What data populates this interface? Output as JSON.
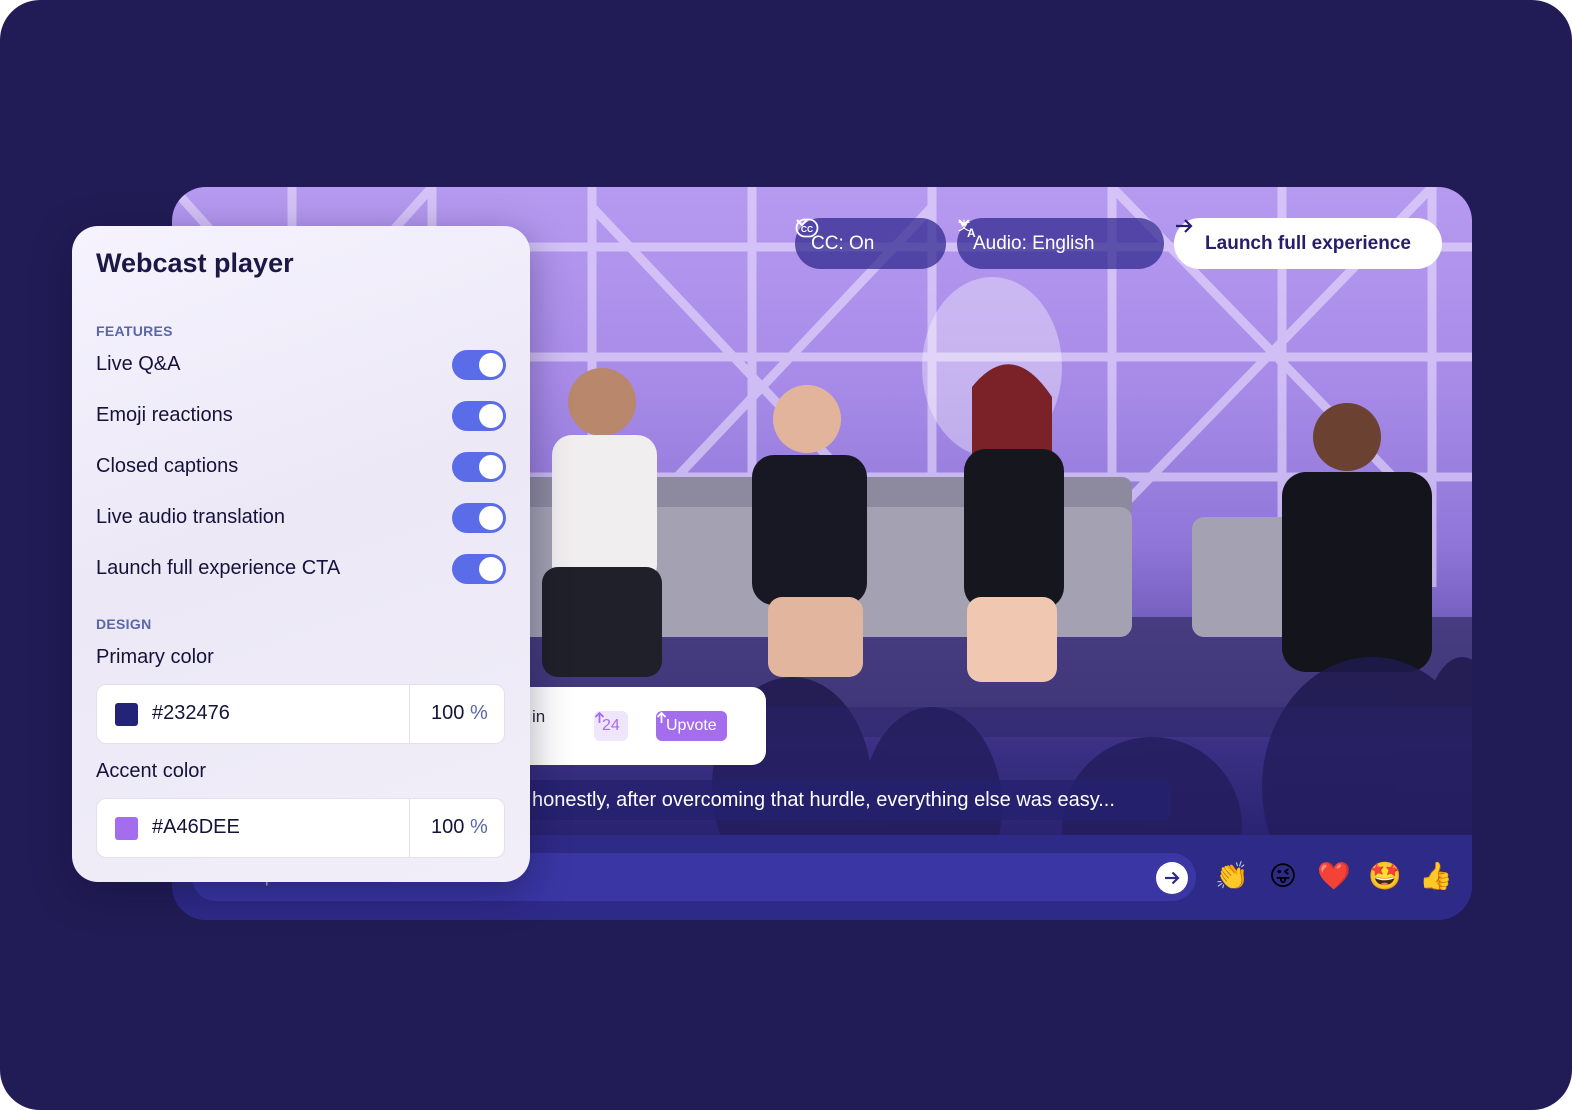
{
  "panel": {
    "title": "Webcast player",
    "features_label": "FEATURES",
    "features": [
      {
        "label": "Live Q&A",
        "enabled": true
      },
      {
        "label": "Emoji reactions",
        "enabled": true
      },
      {
        "label": "Closed captions",
        "enabled": true
      },
      {
        "label": "Live audio translation",
        "enabled": true
      },
      {
        "label": "Launch full experience CTA",
        "enabled": true
      }
    ],
    "design_label": "DESIGN",
    "primary_color": {
      "label": "Primary color",
      "hex": "#232476",
      "opacity": "100",
      "unit": "%"
    },
    "accent_color": {
      "label": "Accent color",
      "hex": "#A46DEE",
      "opacity": "100",
      "unit": "%"
    }
  },
  "player": {
    "cc_label": "CC: On",
    "audio_label": "Audio: English",
    "launch_label": "Launch full experience",
    "qa_card": {
      "snippet": "in",
      "count": "24",
      "upvote_label": "Upvote"
    },
    "caption": "honestly, after overcoming that hurdle, everything else was easy...",
    "question_placeholder": "Ask a question...",
    "reactions": [
      "👏",
      "😜",
      "❤️",
      "🤩",
      "👍"
    ]
  },
  "colors": {
    "background": "#221c56",
    "bar": "#2e2a88",
    "toggle_on": "#5b6ce8",
    "accent": "#A46DEE",
    "primary": "#232476"
  },
  "icons": [
    "cc-icon",
    "chevron-down-icon",
    "translate-icon",
    "arrow-right-icon",
    "arrow-up-icon",
    "send-icon"
  ]
}
